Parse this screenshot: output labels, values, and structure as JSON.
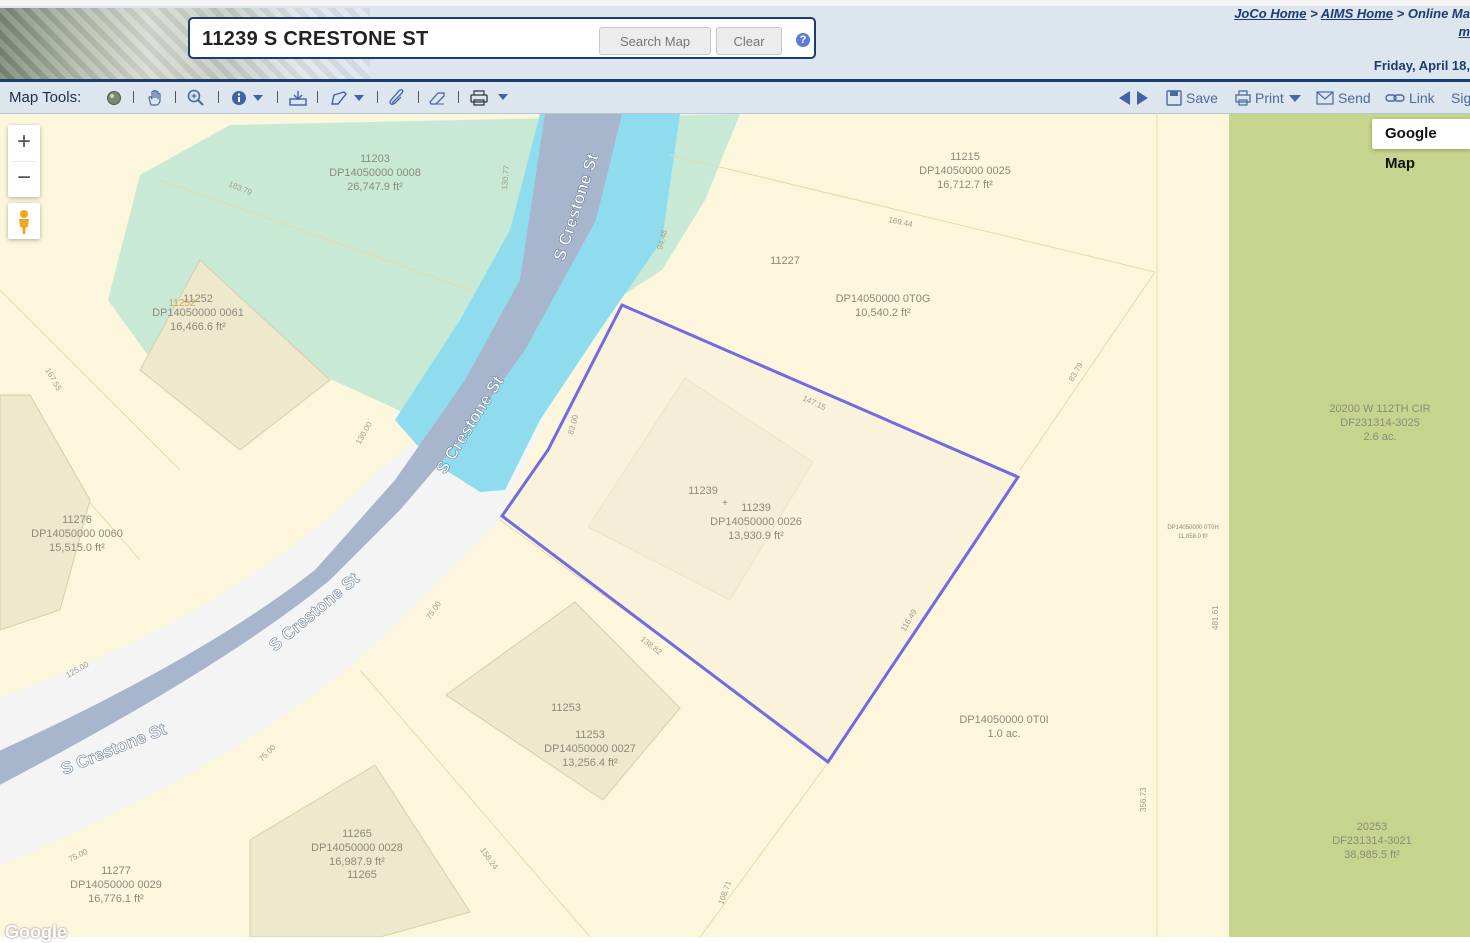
{
  "header": {
    "search_value": "11239 S CRESTONE ST",
    "search_button": "Search Map",
    "clear_button": "Clear",
    "help_glyph": "?",
    "crumb_joco": "JoCo Home",
    "crumb_sep": ">",
    "crumb_aims": "AIMS Home",
    "crumb_online": "Online Ma",
    "crumb_line2": "m",
    "date": "Friday, April 18,"
  },
  "toolbar": {
    "label": "Map Tools:",
    "icons": [
      "globe-icon",
      "hand-pan-icon",
      "zoom-icon",
      "info-icon",
      "layers-icon",
      "draw-icon",
      "measure-icon",
      "erase-icon",
      "print-map-icon"
    ],
    "right": {
      "save": "Save",
      "print": "Print",
      "send": "Send",
      "link": "Link",
      "sign": "Sig"
    }
  },
  "map": {
    "zoom_in": "+",
    "zoom_out": "−",
    "google_map_button": "Google Map",
    "google_logo": "Google",
    "streets": [
      "S Crestone St",
      "S Crestone St",
      "S Crestone St",
      "S Crestone St"
    ],
    "parcels": [
      {
        "lines": [
          "11203",
          "DP14050000 0008",
          "26,747.9 ft²"
        ]
      },
      {
        "lines": [
          "11215",
          "DP14050000 0025",
          "16,712.7 ft²"
        ]
      },
      {
        "lines": [
          "11227"
        ]
      },
      {
        "lines": [
          "DP14050000 0T0G",
          "10,540.2 ft²"
        ]
      },
      {
        "lines": [
          "11252",
          "DP14050000 0061",
          "16,466.6 ft²"
        ],
        "overlay": "11252"
      },
      {
        "lines": [
          "11276",
          "DP14050000 0060",
          "15,515.0 ft²"
        ]
      },
      {
        "lines": [
          "11239"
        ]
      },
      {
        "lines": [
          "11239",
          "DP14050000 0026",
          "13,930.9 ft²"
        ]
      },
      {
        "lines": [
          "20200 W 112TH CIR",
          "DF231314-3025",
          "2.6 ac."
        ]
      },
      {
        "lines": [
          "DP14050000 0T0H",
          "11,858.0 ft²"
        ]
      },
      {
        "lines": [
          "11253"
        ]
      },
      {
        "lines": [
          "11253",
          "DP14050000 0027",
          "13,256.4 ft²"
        ]
      },
      {
        "lines": [
          "DP14050000 0T0I",
          "1.0 ac."
        ]
      },
      {
        "lines": [
          "11265",
          "DP14050000 0028",
          "16,987.9 ft²",
          "11265"
        ]
      },
      {
        "lines": [
          "11277",
          "DP14050000 0029",
          "16,776.1 ft²"
        ]
      },
      {
        "lines": [
          "20253",
          "DF231314-3021",
          "38,985.5 ft²"
        ]
      }
    ],
    "dimensions": [
      "183.79",
      "130.77",
      "94.48",
      "169.44",
      "167.55",
      "130.00",
      "82.00",
      "147.15",
      "83.79",
      "116.49",
      "138.82",
      "75.00",
      "125.00",
      "75.00",
      "75.00",
      "158.24",
      "108.71",
      "356.73",
      "481.61"
    ],
    "colors": {
      "land": "#fcf6dc",
      "greenspace": "#c8e9d6",
      "water": "#8fdcef",
      "road_edge": "#f4f4f4",
      "road": "#a7b6cc",
      "selection": "#7468e3",
      "park": "#c7d48d"
    }
  }
}
